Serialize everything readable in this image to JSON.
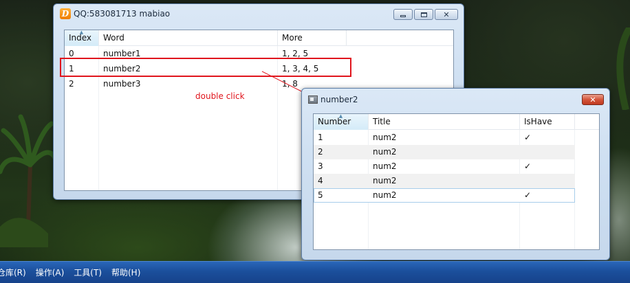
{
  "main_window": {
    "title": "QQ:583081713 mabiao",
    "columns": [
      "Index",
      "Word",
      "More"
    ],
    "rows": [
      {
        "index": "0",
        "word": "number1",
        "more": "1, 2, 5"
      },
      {
        "index": "1",
        "word": "number2",
        "more": "1, 3, 4, 5"
      },
      {
        "index": "2",
        "word": "number3",
        "more": "1, 8"
      }
    ]
  },
  "annotation": {
    "text": "double click",
    "color": "#e0141c"
  },
  "child_window": {
    "title": "number2",
    "columns": [
      "Number",
      "Title",
      "IsHave"
    ],
    "rows": [
      {
        "number": "1",
        "title": "num2",
        "ishave": "✓"
      },
      {
        "number": "2",
        "title": "num2",
        "ishave": ""
      },
      {
        "number": "3",
        "title": "num2",
        "ishave": "✓"
      },
      {
        "number": "4",
        "title": "num2",
        "ishave": ""
      },
      {
        "number": "5",
        "title": "num2",
        "ishave": "✓"
      }
    ]
  },
  "taskbar": {
    "menu": [
      "仓库(R)",
      "操作(A)",
      "工具(T)",
      "帮助(H)"
    ]
  },
  "colors": {
    "taskbar": "#1b4f9c",
    "selection_border": "#a7cdea",
    "annotation": "#e0141c"
  }
}
